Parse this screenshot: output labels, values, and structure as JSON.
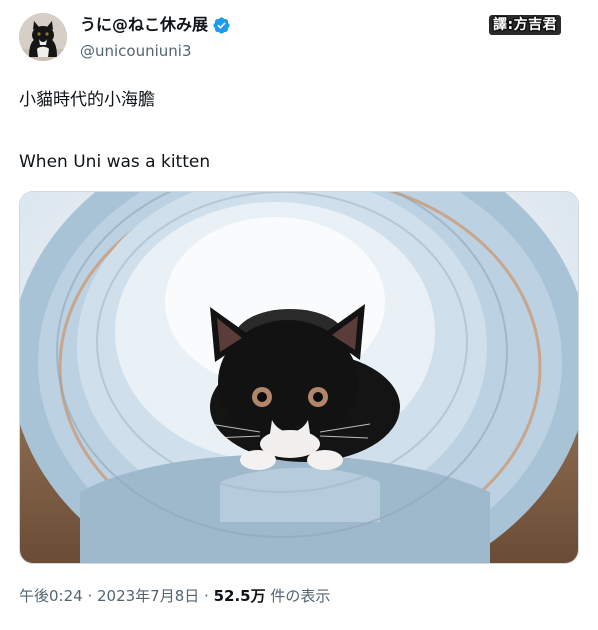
{
  "author": {
    "display_name": "うに@ねこ休み展",
    "handle": "@unicouniuni3",
    "verified_color": "#1d9bf0"
  },
  "translator_badge": "譯:方吉君",
  "tweet": {
    "line1": "小貓時代的小海膽",
    "line2": "When Uni was a kitten"
  },
  "meta": {
    "time": "午後0:24",
    "separator": " · ",
    "date": "2023年7月8日",
    "views_count": "52.5万",
    "views_label": " 件の表示"
  },
  "colors": {
    "text": "#0f1419",
    "secondary": "#536471",
    "border": "#cfd9de"
  }
}
